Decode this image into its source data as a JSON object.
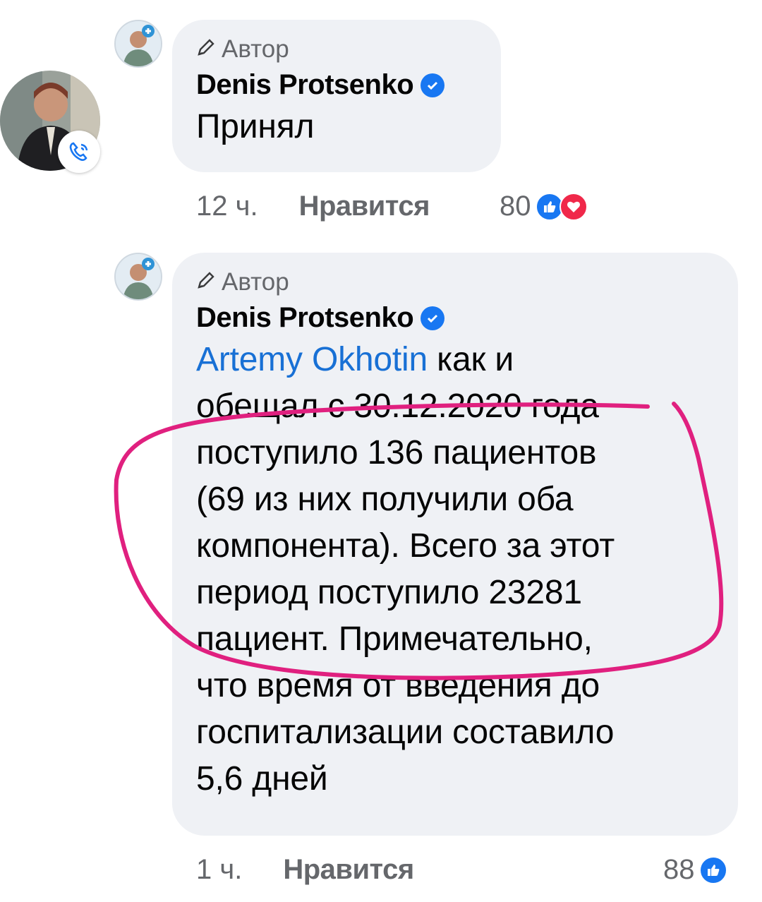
{
  "comments": [
    {
      "author_badge": "Автор",
      "author_name": "Denis Protsenko",
      "text": "Принял",
      "time": "12 ч.",
      "like_label": "Нравится",
      "reaction_count": "80",
      "reactions": [
        "like-icon",
        "love-icon"
      ]
    },
    {
      "author_badge": "Автор",
      "author_name": "Denis Protsenko",
      "mention": "Artemy Okhotin",
      "lines": [
        " как и",
        "обещал с 30.12.2020 года",
        "поступило 136 пациентов",
        "(69 из них получили оба",
        "компонента). Всего за этот",
        "период поступило 23281",
        "пациент. Примечательно,",
        "что время от введения до",
        "госпитализации составило",
        "5,6 дней"
      ],
      "time": "1 ч.",
      "like_label": "Нравится",
      "reaction_count": "88",
      "reactions": [
        "like-icon"
      ]
    }
  ],
  "colors": {
    "bubble": "#eff1f5",
    "mention": "#1870d5",
    "annotation_stroke": "#e0207f",
    "like_blue": "#1877f2",
    "love_red": "#f0284a"
  }
}
